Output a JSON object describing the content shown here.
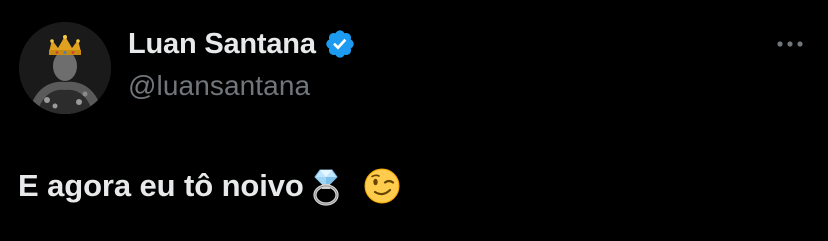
{
  "tweet": {
    "author": {
      "display_name": "Luan Santana",
      "handle": "@luansantana",
      "verified": true,
      "avatar_icon": "crowned-man-avatar"
    },
    "more_icon": "more-options-icon",
    "text": "E agora eu tô noivo",
    "emojis": [
      "ring-emoji",
      "winking-face-emoji"
    ]
  },
  "colors": {
    "background": "#000000",
    "primary_text": "#e7e9ea",
    "secondary_text": "#71767b",
    "verified_blue": "#1d9bf0"
  }
}
